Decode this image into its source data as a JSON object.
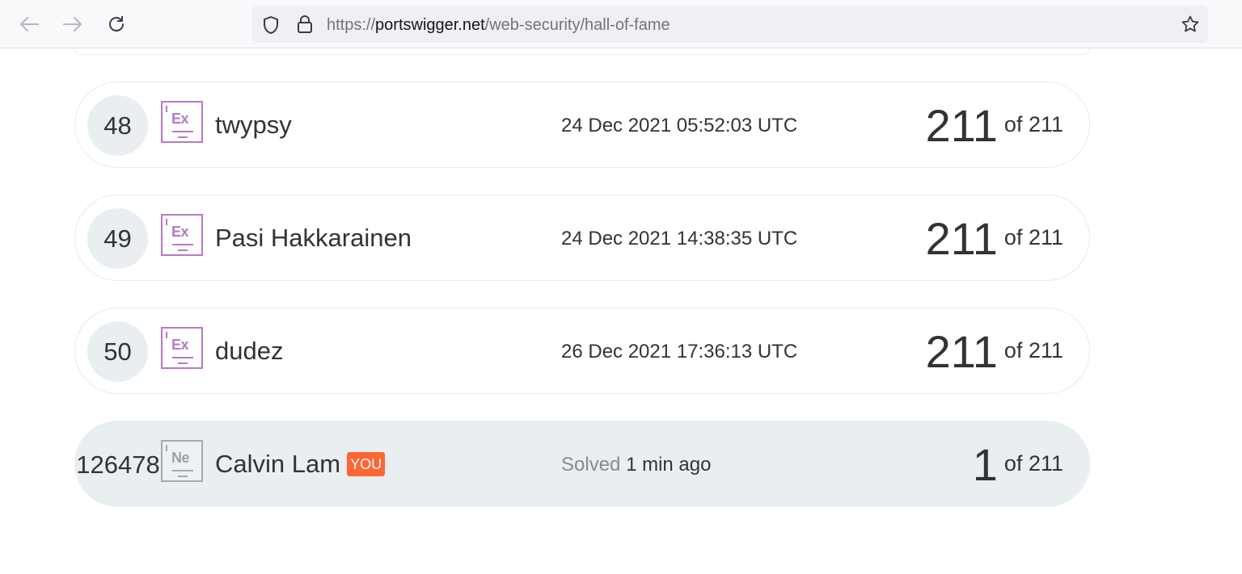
{
  "browser": {
    "url_prefix": "https://",
    "url_host": "portswigger.net",
    "url_path": "/web-security/hall-of-fame"
  },
  "leaderboard": [
    {
      "rank": "48",
      "badge": "Ex",
      "name": "twypsy",
      "date": "24 Dec 2021 05:52:03 UTC",
      "solved": "211",
      "of": "of 211"
    },
    {
      "rank": "49",
      "badge": "Ex",
      "name": "Pasi Hakkarainen",
      "date": "24 Dec 2021 14:38:35 UTC",
      "solved": "211",
      "of": "of 211"
    },
    {
      "rank": "50",
      "badge": "Ex",
      "name": "dudez",
      "date": "26 Dec 2021 17:36:13 UTC",
      "solved": "211",
      "of": "of 211"
    }
  ],
  "you_row": {
    "rank": "126478",
    "badge": "Ne",
    "name": "Calvin Lam",
    "tag": "YOU",
    "date_prefix": "Solved",
    "date_value": "1 min ago",
    "solved": "1",
    "of": "of 211"
  },
  "colors": {
    "expert_badge": "#b57ac6",
    "novice_badge": "#a8a8a8",
    "you_tag": "#ff6633",
    "you_row_bg": "#e9eef1"
  }
}
